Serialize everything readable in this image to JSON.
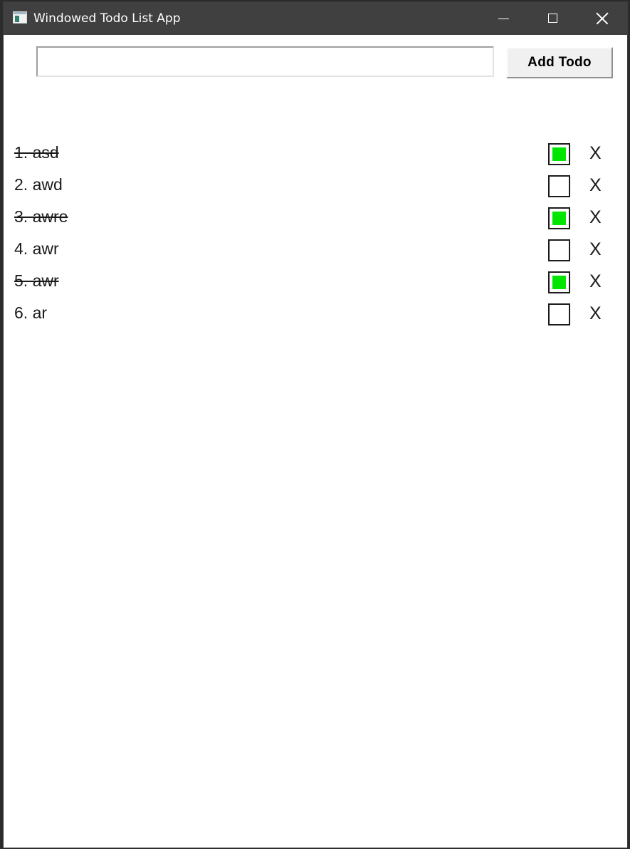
{
  "window": {
    "title": "Windowed Todo List App"
  },
  "form": {
    "input_value": "",
    "input_placeholder": "",
    "add_label": "Add Todo"
  },
  "todos": [
    {
      "label": "1. asd",
      "done": true,
      "delete_label": "X"
    },
    {
      "label": "2. awd",
      "done": false,
      "delete_label": "X"
    },
    {
      "label": "3. awre",
      "done": true,
      "delete_label": "X"
    },
    {
      "label": "4. awr",
      "done": false,
      "delete_label": "X"
    },
    {
      "label": "5. awr",
      "done": true,
      "delete_label": "X"
    },
    {
      "label": "6. ar",
      "done": false,
      "delete_label": "X"
    }
  ],
  "colors": {
    "titlebar": "#404040",
    "done_fill": "#00e600"
  }
}
